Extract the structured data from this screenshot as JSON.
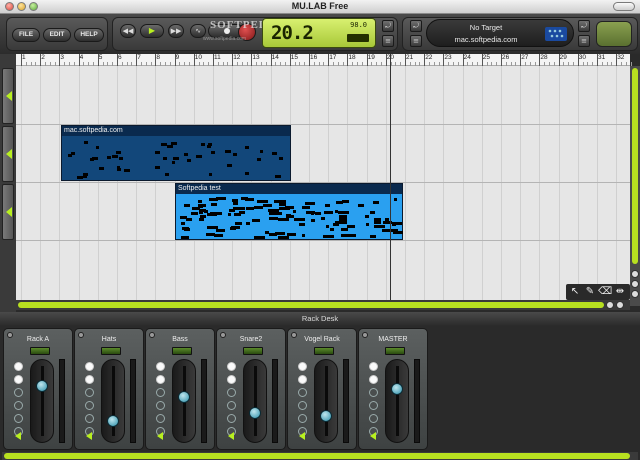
{
  "window": {
    "title": "MU.LAB Free"
  },
  "toolbar": {
    "file_label": "FILE",
    "edit_label": "EDIT",
    "help_label": "HELP",
    "watermark": "SOFTPEDIA",
    "watermark_sub": "www.softpedia.com",
    "time_display": "20.2",
    "tempo": "98.0"
  },
  "target": {
    "label": "No Target",
    "host": "mac.softpedia.com"
  },
  "ruler": {
    "bars": [
      "1",
      "2",
      "3",
      "4",
      "5",
      "6",
      "7",
      "8",
      "9",
      "10",
      "11",
      "12",
      "13",
      "14",
      "15",
      "16",
      "17",
      "18",
      "19",
      "20",
      "21",
      "22",
      "23",
      "24",
      "25",
      "26",
      "27",
      "28",
      "29",
      "30",
      "31",
      "32"
    ]
  },
  "clips": [
    {
      "title": "mac.softpedia.com",
      "color": "#12477a"
    },
    {
      "title": "Softpedia test",
      "color": "#2aa0f0"
    }
  ],
  "rack": {
    "title": "Rack Desk",
    "channels": [
      {
        "name": "Rack A",
        "level": 0.76
      },
      {
        "name": "Hats",
        "level": 0.16
      },
      {
        "name": "Bass",
        "level": 0.57
      },
      {
        "name": "Snare2",
        "level": 0.3
      },
      {
        "name": "Vogel Rack",
        "level": 0.24
      },
      {
        "name": "MASTER",
        "level": 0.7
      }
    ]
  },
  "icons": {
    "rewind": "rewind-icon",
    "play": "play-icon",
    "fast_forward": "fast-forward-icon",
    "pointer": "pointer-tool-icon",
    "pencil": "pencil-tool-icon",
    "eraser": "eraser-tool-icon",
    "split": "split-tool-icon"
  },
  "colors": {
    "accent": "#b8f020",
    "lcd": "#c8e050"
  }
}
